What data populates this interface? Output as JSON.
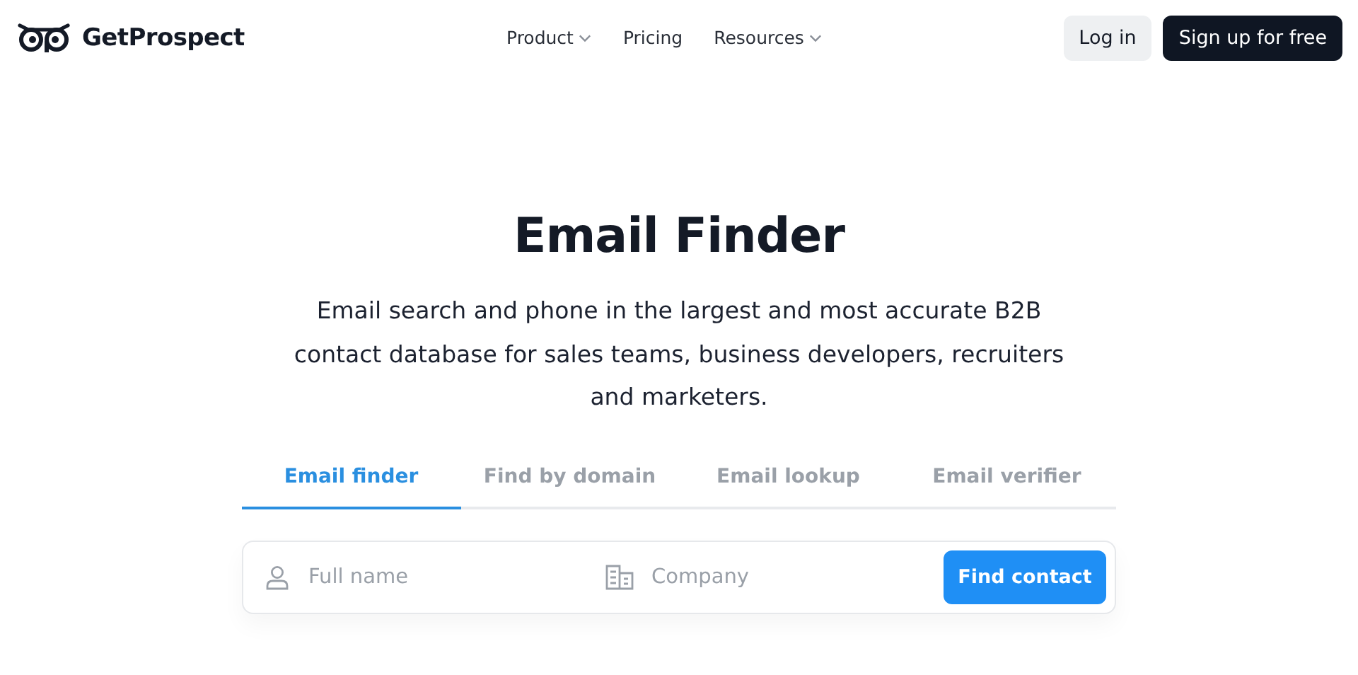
{
  "header": {
    "brand": "GetProspect",
    "nav": [
      {
        "label": "Product",
        "has_menu": true
      },
      {
        "label": "Pricing",
        "has_menu": false
      },
      {
        "label": "Resources",
        "has_menu": true
      }
    ],
    "login": "Log in",
    "signup": "Sign up for free"
  },
  "hero": {
    "title": "Email Finder",
    "description": "Email search and phone in the largest and most accurate B2B contact database for sales teams, business developers, recruiters and marketers."
  },
  "tabs": [
    {
      "label": "Email finder",
      "selected": true
    },
    {
      "label": "Find by domain",
      "selected": false
    },
    {
      "label": "Email lookup",
      "selected": false
    },
    {
      "label": "Email verifier",
      "selected": false
    }
  ],
  "search": {
    "fields": [
      {
        "kind": "person",
        "placeholder": "Full name"
      },
      {
        "kind": "company",
        "placeholder": "Company"
      }
    ],
    "button": "Find contact"
  }
}
